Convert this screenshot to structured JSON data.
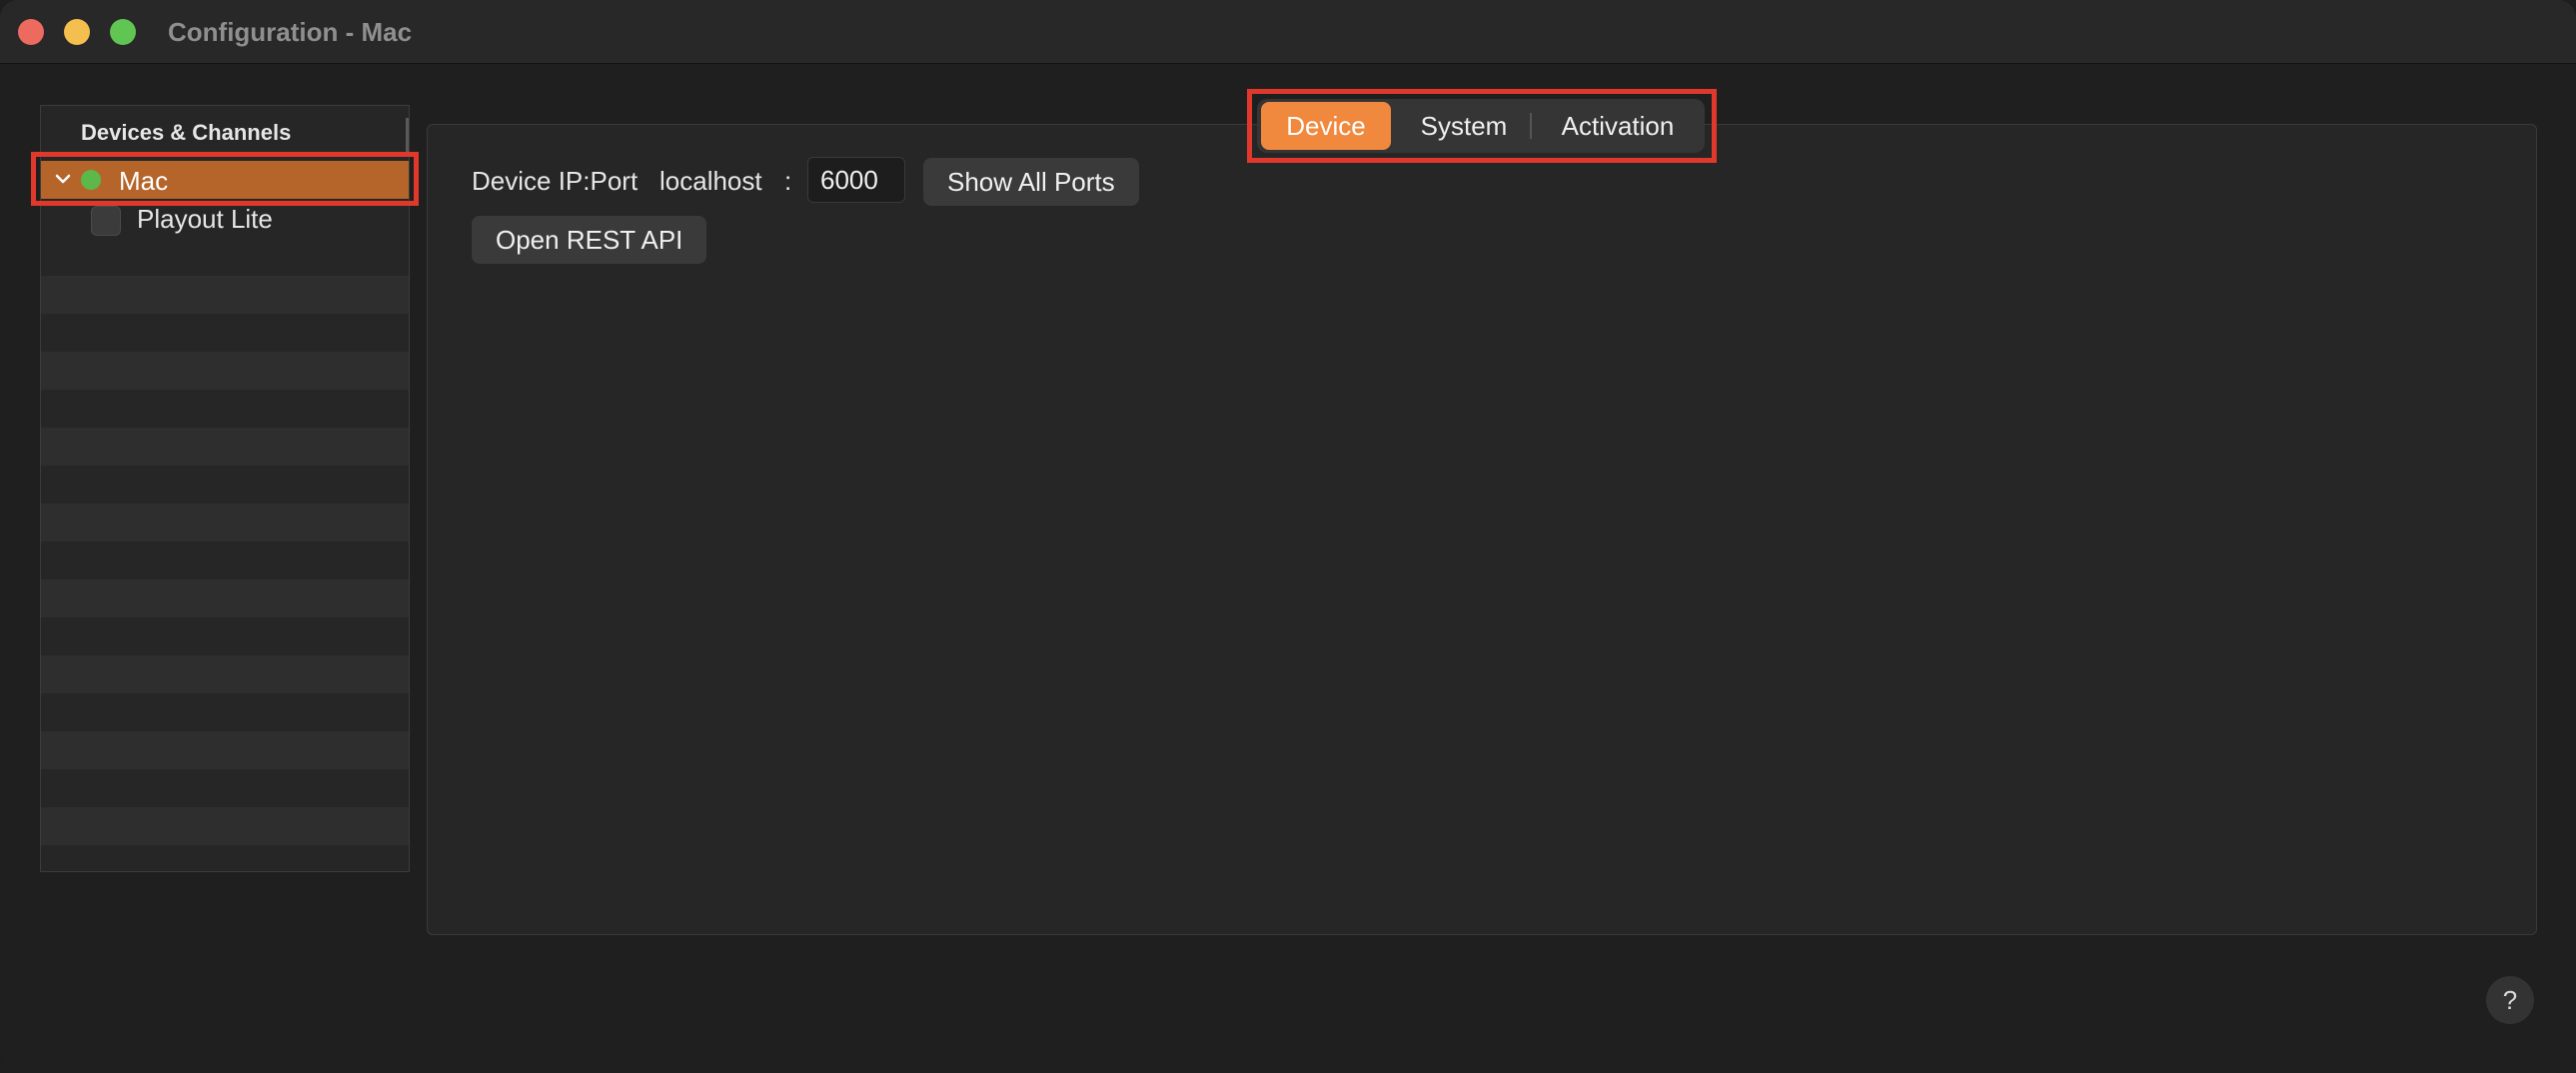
{
  "window": {
    "title": "Configuration - Mac"
  },
  "sidebar": {
    "header": "Devices & Channels",
    "items": [
      {
        "label": "Mac",
        "status_color": "#5cb84a",
        "expanded": true,
        "selected": true
      },
      {
        "label": "Playout Lite",
        "checked": false
      }
    ]
  },
  "tabs": [
    {
      "label": "Device",
      "active": true
    },
    {
      "label": "System",
      "active": false
    },
    {
      "label": "Activation",
      "active": false
    }
  ],
  "device": {
    "ip_port_label": "Device IP:Port",
    "host": "localhost",
    "separator": ":",
    "port": "6000",
    "show_ports_label": "Show All Ports",
    "open_rest_label": "Open REST API"
  },
  "help": {
    "label": "?"
  },
  "colors": {
    "accent": "#f0893e",
    "selection": "#b5652a",
    "highlight": "#e0392b"
  }
}
